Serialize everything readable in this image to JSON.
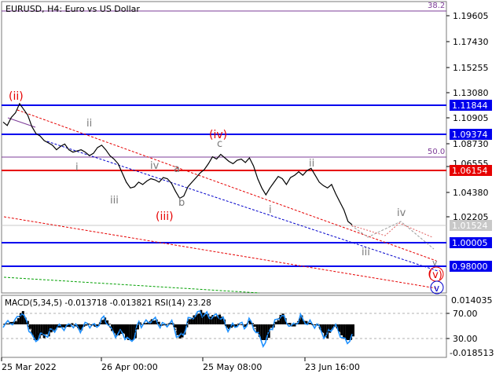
{
  "header": {
    "symbol_title": "EURUSD, H4:  Euro vs US Dollar",
    "fib_top_label": "38.2",
    "fib_mid_label": "50.0"
  },
  "price_axis": {
    "ticks": [
      "1.19605",
      "1.17430",
      "1.15255",
      "1.13080",
      "1.10905",
      "1.08730",
      "1.06555",
      "1.04380",
      "1.02205"
    ],
    "labels": [
      {
        "text": "1.11844",
        "bg": "#0000ee",
        "fg": "#ffffff"
      },
      {
        "text": "1.09374",
        "bg": "#0000ee",
        "fg": "#ffffff"
      },
      {
        "text": "1.06154",
        "bg": "#e60000",
        "fg": "#ffffff"
      },
      {
        "text": "1.01524",
        "bg": "#c8c8c8",
        "fg": "#ffffff"
      },
      {
        "text": "1.00005",
        "bg": "#0000ee",
        "fg": "#ffffff"
      },
      {
        "text": "0.98000",
        "bg": "#0000ee",
        "fg": "#ffffff"
      }
    ]
  },
  "wave_labels": {
    "ii_red": "(ii)",
    "ii_gray_1": "ii",
    "i_1": "i",
    "iii_1": "iii",
    "iv_1": "iv",
    "a": "a",
    "b": "b",
    "c": "c",
    "iii_red": "(iii)",
    "iv_red": "(iv)",
    "ii_gray_2": "ii",
    "i_2": "i",
    "iv_2": "iv",
    "iii_2": "iii",
    "v_small": "v",
    "v_red": "(v)",
    "v_blue": "v"
  },
  "indicator": {
    "title": "MACD(5,34,5) -0.013718 -0.013821 RSI(14) 23.28",
    "ticks": [
      "0.014035",
      "70.00",
      "30.00",
      "-0.018513"
    ]
  },
  "time_axis": {
    "labels": [
      "25 Mar 2022",
      "26 Apr 00:00",
      "25 May 08:00",
      "23 Jun 16:00"
    ]
  },
  "chart_data": {
    "type": "line",
    "symbol": "EURUSD",
    "timeframe": "H4",
    "x": [
      "25 Mar 2022",
      "26 Apr 00:00",
      "25 May 08:00",
      "23 Jun 16:00"
    ],
    "series": [
      {
        "values": [
          1.104,
          1.101,
          1.108,
          1.112,
          1.12,
          1.115,
          1.11,
          1.1,
          1.094,
          1.092,
          1.088,
          1.086,
          1.084,
          1.08,
          1.083,
          1.085,
          1.08,
          1.078,
          1.079,
          1.08,
          1.078,
          1.075,
          1.077,
          1.082,
          1.084,
          1.08,
          1.075,
          1.072,
          1.068,
          1.06,
          1.052,
          1.047,
          1.048,
          1.052,
          1.05,
          1.053,
          1.055,
          1.054,
          1.052,
          1.056,
          1.055,
          1.051,
          1.044,
          1.038,
          1.04,
          1.048,
          1.052,
          1.056,
          1.06,
          1.063,
          1.068,
          1.074,
          1.072,
          1.076,
          1.073,
          1.07,
          1.068,
          1.071,
          1.072,
          1.069,
          1.073,
          1.066,
          1.055,
          1.047,
          1.041,
          1.047,
          1.052,
          1.057,
          1.055,
          1.05,
          1.056,
          1.058,
          1.061,
          1.058,
          1.062,
          1.064,
          1.058,
          1.052,
          1.049,
          1.047,
          1.05,
          1.042,
          1.035,
          1.028,
          1.018,
          1.0152
        ]
      }
    ]
  }
}
